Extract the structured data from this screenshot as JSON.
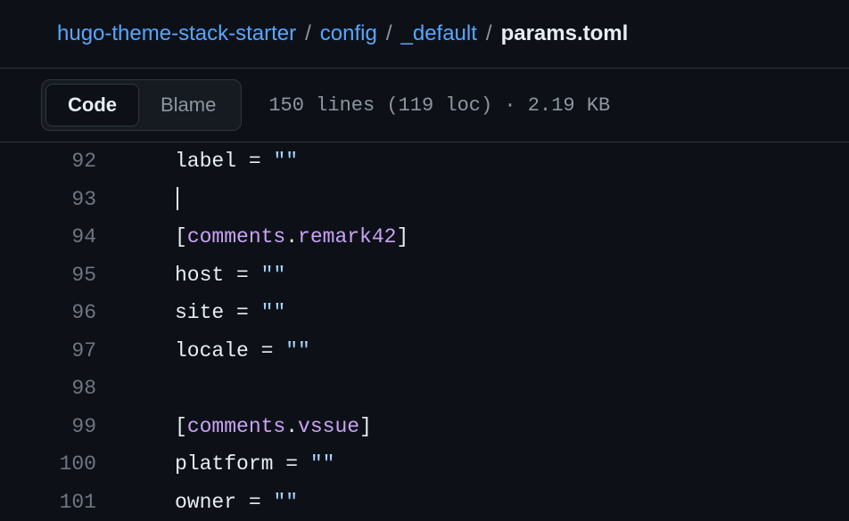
{
  "breadcrumb": {
    "items": [
      {
        "label": "hugo-theme-stack-starter",
        "link": true
      },
      {
        "label": "config",
        "link": true
      },
      {
        "label": "_default",
        "link": true
      },
      {
        "label": "params.toml",
        "link": false
      }
    ],
    "sep": "/"
  },
  "toolbar": {
    "tabs": {
      "code": "Code",
      "blame": "Blame"
    },
    "fileinfo": "150 lines (119 loc) · 2.19 KB"
  },
  "code": {
    "lines": [
      {
        "num": "92",
        "tokens": [
          {
            "t": "key",
            "v": "label"
          },
          {
            "t": "eq",
            "v": " = "
          },
          {
            "t": "str",
            "v": "\"\""
          }
        ]
      },
      {
        "num": "93",
        "tokens": [],
        "cursor": true
      },
      {
        "num": "94",
        "tokens": [
          {
            "t": "bracket",
            "v": "["
          },
          {
            "t": "section",
            "v": "comments"
          },
          {
            "t": "bracket",
            "v": "."
          },
          {
            "t": "section",
            "v": "remark42"
          },
          {
            "t": "bracket",
            "v": "]"
          }
        ]
      },
      {
        "num": "95",
        "tokens": [
          {
            "t": "key",
            "v": "host"
          },
          {
            "t": "eq",
            "v": " = "
          },
          {
            "t": "str",
            "v": "\"\""
          }
        ]
      },
      {
        "num": "96",
        "tokens": [
          {
            "t": "key",
            "v": "site"
          },
          {
            "t": "eq",
            "v": " = "
          },
          {
            "t": "str",
            "v": "\"\""
          }
        ]
      },
      {
        "num": "97",
        "tokens": [
          {
            "t": "key",
            "v": "locale"
          },
          {
            "t": "eq",
            "v": " = "
          },
          {
            "t": "str",
            "v": "\"\""
          }
        ]
      },
      {
        "num": "98",
        "tokens": []
      },
      {
        "num": "99",
        "tokens": [
          {
            "t": "bracket",
            "v": "["
          },
          {
            "t": "section",
            "v": "comments"
          },
          {
            "t": "bracket",
            "v": "."
          },
          {
            "t": "section",
            "v": "vssue"
          },
          {
            "t": "bracket",
            "v": "]"
          }
        ]
      },
      {
        "num": "100",
        "tokens": [
          {
            "t": "key",
            "v": "platform"
          },
          {
            "t": "eq",
            "v": " = "
          },
          {
            "t": "str",
            "v": "\"\""
          }
        ]
      },
      {
        "num": "101",
        "tokens": [
          {
            "t": "key",
            "v": "owner"
          },
          {
            "t": "eq",
            "v": " = "
          },
          {
            "t": "str",
            "v": "\"\""
          }
        ]
      }
    ]
  }
}
